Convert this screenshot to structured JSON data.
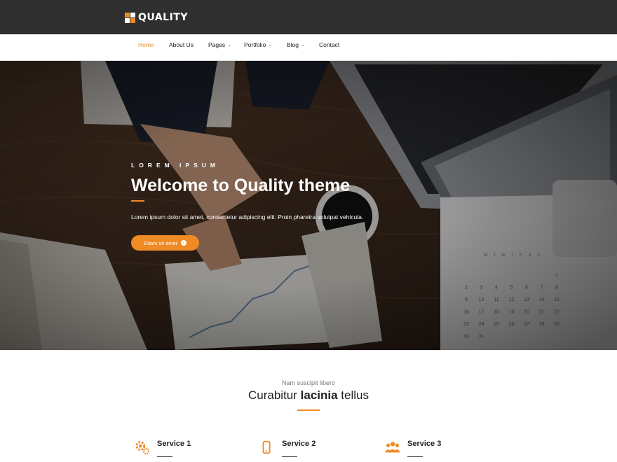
{
  "brand": {
    "name": "QUALITY",
    "accent": "#f08a24"
  },
  "nav": {
    "items": [
      {
        "label": "Home",
        "active": true,
        "dropdown": false
      },
      {
        "label": "About Us",
        "active": false,
        "dropdown": false
      },
      {
        "label": "Pages",
        "active": false,
        "dropdown": true
      },
      {
        "label": "Portfolio",
        "active": false,
        "dropdown": true
      },
      {
        "label": "Blog",
        "active": false,
        "dropdown": true
      },
      {
        "label": "Contact",
        "active": false,
        "dropdown": false
      }
    ]
  },
  "hero": {
    "eyebrow": "LOREM IPSUM",
    "title": "Welcome to Quality theme",
    "text": "Lorem ipsum dolor sit amet, consectetur adipiscing elit. Proin pharetra volutpat vehicula.",
    "button": "Etiam sit amet",
    "calendar": {
      "weekdays": [
        "M",
        "T",
        "W",
        "T",
        "F",
        "S",
        "S"
      ],
      "rows": [
        [
          "",
          "",
          "",
          "",
          "",
          "",
          "1"
        ],
        [
          "2",
          "3",
          "4",
          "5",
          "6",
          "7",
          "8"
        ],
        [
          "9",
          "10",
          "11",
          "12",
          "13",
          "14",
          "15"
        ],
        [
          "16",
          "17",
          "18",
          "19",
          "20",
          "21",
          "22"
        ],
        [
          "23",
          "24",
          "25",
          "26",
          "27",
          "28",
          "29"
        ],
        [
          "30",
          "31",
          "",
          "",
          "",
          "",
          ""
        ]
      ]
    }
  },
  "services_section": {
    "subtitle": "Nam suscipit libero",
    "title_prefix": "Curabitur ",
    "title_bold": "lacinia",
    "title_suffix": " tellus",
    "items": [
      {
        "name": "Service 1",
        "icon": "gears-icon"
      },
      {
        "name": "Service 2",
        "icon": "mobile-icon"
      },
      {
        "name": "Service 3",
        "icon": "users-icon"
      }
    ]
  }
}
